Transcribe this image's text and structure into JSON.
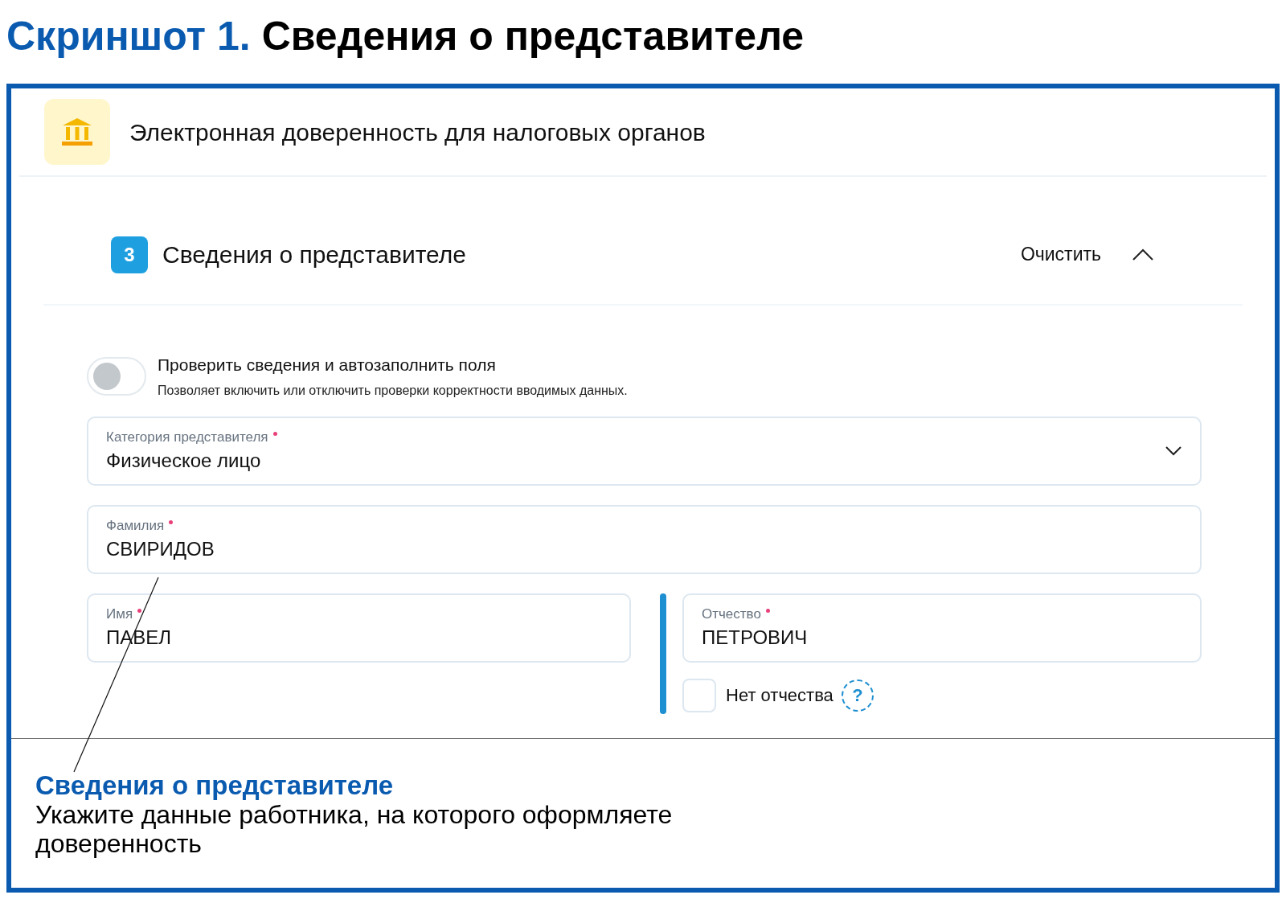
{
  "figure_title": {
    "label": "Скриншот 1.",
    "text": "Сведения о представителе"
  },
  "header": {
    "title": "Электронная доверенность для налоговых органов"
  },
  "section": {
    "number": "3",
    "title": "Сведения о представителе",
    "clear_button": "Очистить",
    "expanded": true
  },
  "toggle": {
    "label": "Проверить сведения и автозаполнить поля",
    "description": "Позволяет включить или отключить проверки корректности вводимых данных.",
    "on": false
  },
  "category": {
    "label": "Категория представителя",
    "required": true,
    "value": "Физическое лицо"
  },
  "surname": {
    "label": "Фамилия",
    "required": true,
    "value": "СВИРИДОВ"
  },
  "name": {
    "label": "Имя",
    "required": true,
    "value": "ПАВЕЛ"
  },
  "patronymic": {
    "label": "Отчество",
    "required": true,
    "value": "ПЕТРОВИЧ"
  },
  "no_patronymic": {
    "label": "Нет отчества",
    "checked": false,
    "help": "?"
  },
  "callout": {
    "title": "Сведения о представителе",
    "text": "Укажите данные работника, на которого оформляете доверенность"
  }
}
